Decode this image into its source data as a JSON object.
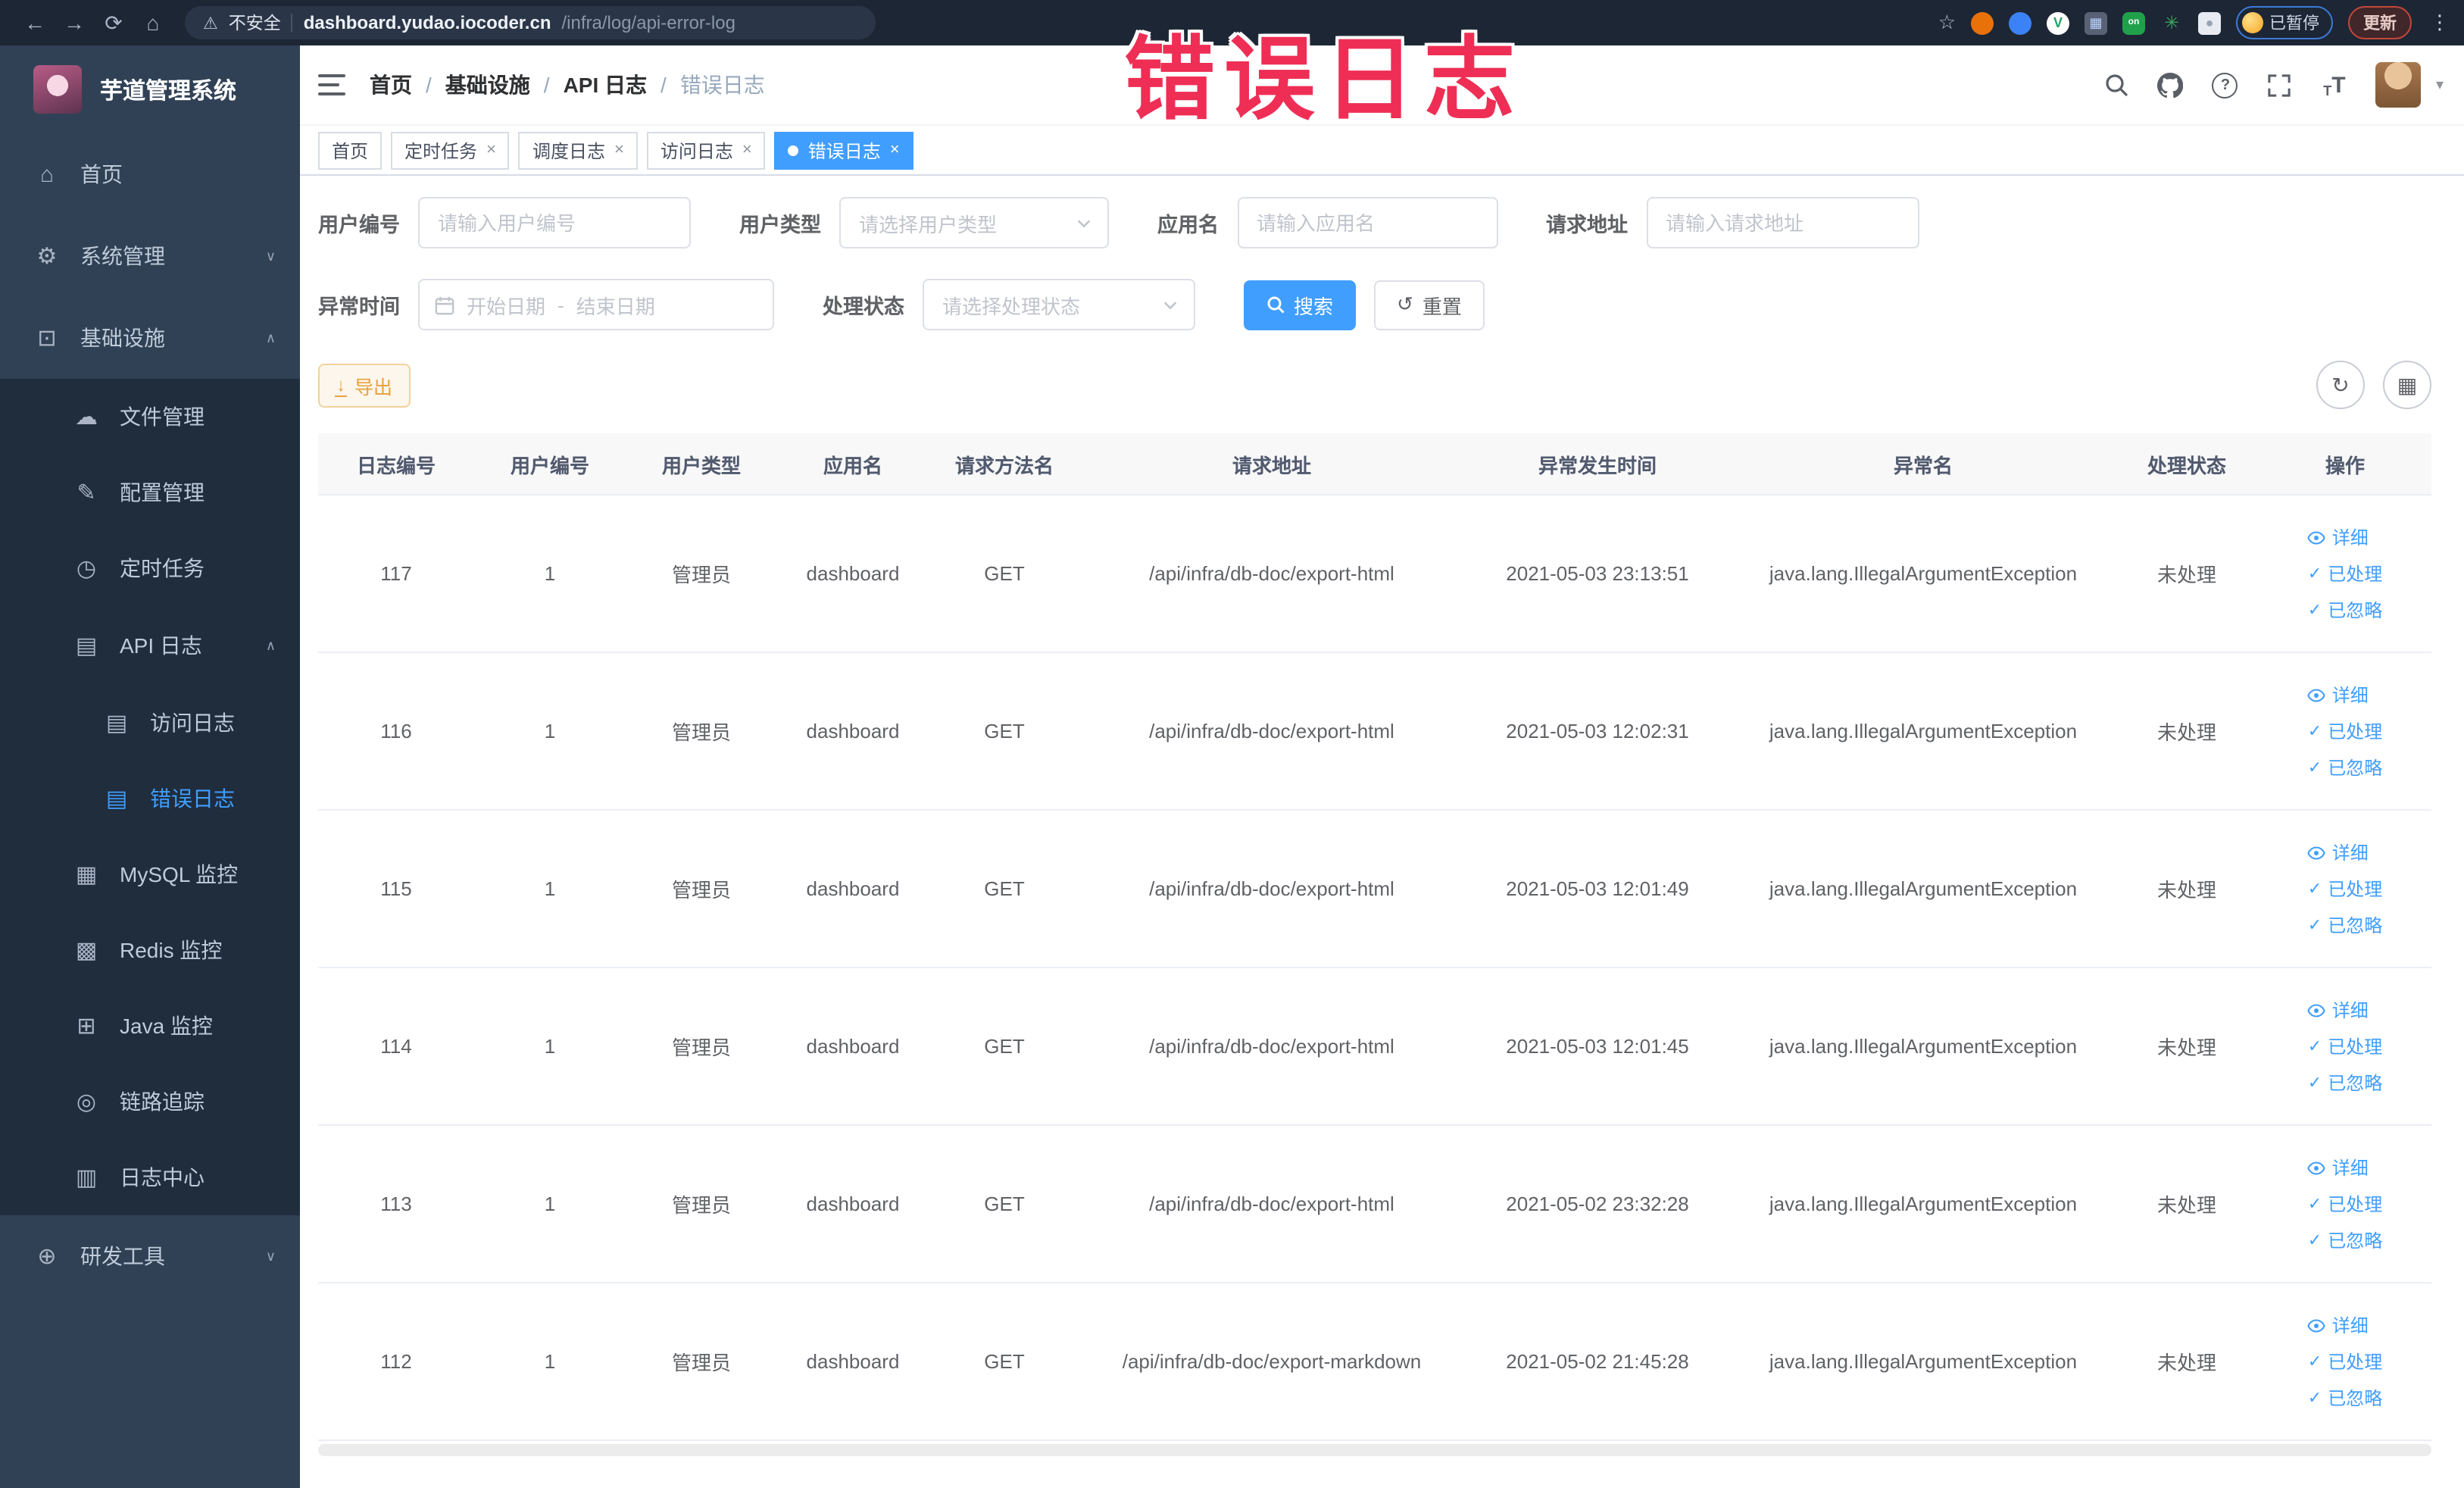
{
  "icons": {
    "back": "←",
    "forward": "→",
    "reload": "⟳",
    "home": "⌂",
    "warning": "⚠",
    "star": "☆",
    "dots": "⋮",
    "on_badge": "on",
    "close": "×",
    "breadcrumb_sep": "/",
    "caret_down": "▾",
    "check": "✓",
    "refresh": "↻",
    "reset": "↺",
    "columns_grid": "▦",
    "download_arrow": "↓",
    "ext_v": "V",
    "ext_grid": "▦",
    "ext_leaf": "✳",
    "ext_dot": "●",
    "home_glyph": "⌂",
    "gear_glyph": "⚙",
    "infra_glyph": "⊡",
    "cloud_glyph": "☁",
    "edit_glyph": "✎",
    "timer_glyph": "◷",
    "doc_glyph": "▤",
    "mysql_glyph": "▦",
    "redis_glyph": "▩",
    "java_glyph": "⊞",
    "eye_glyph": "◎",
    "logcenter_glyph": "▥",
    "tools_glyph": "⊕",
    "chev_down": "∨",
    "chev_up": "∧"
  },
  "browser": {
    "security_label": "不安全",
    "url_host": "dashboard.yudao.iocoder.cn",
    "url_path": "/infra/log/api-error-log",
    "paused_label": "已暂停",
    "update_label": "更新"
  },
  "overlay": {
    "text": "错误日志"
  },
  "sidebar": {
    "title": "芋道管理系统",
    "items": [
      {
        "label": "首页"
      },
      {
        "label": "系统管理"
      },
      {
        "label": "基础设施"
      },
      {
        "label": "文件管理"
      },
      {
        "label": "配置管理"
      },
      {
        "label": "定时任务"
      },
      {
        "label": "API 日志"
      },
      {
        "label": "访问日志"
      },
      {
        "label": "错误日志"
      },
      {
        "label": "MySQL 监控"
      },
      {
        "label": "Redis 监控"
      },
      {
        "label": "Java 监控"
      },
      {
        "label": "链路追踪"
      },
      {
        "label": "日志中心"
      },
      {
        "label": "研发工具"
      }
    ]
  },
  "breadcrumb": [
    "首页",
    "基础设施",
    "API 日志",
    "错误日志"
  ],
  "tabs": [
    {
      "label": "首页"
    },
    {
      "label": "定时任务"
    },
    {
      "label": "调度日志"
    },
    {
      "label": "访问日志"
    },
    {
      "label": "错误日志"
    }
  ],
  "filters": {
    "user_id": {
      "label": "用户编号",
      "placeholder": "请输入用户编号"
    },
    "user_type": {
      "label": "用户类型",
      "placeholder": "请选择用户类型"
    },
    "app_name": {
      "label": "应用名",
      "placeholder": "请输入应用名"
    },
    "request_url": {
      "label": "请求地址",
      "placeholder": "请输入请求地址"
    },
    "exception_time": {
      "label": "异常时间",
      "start": "开始日期",
      "separator": "-",
      "end": "结束日期"
    },
    "status": {
      "label": "处理状态",
      "placeholder": "请选择处理状态"
    },
    "search": "搜索",
    "reset": "重置"
  },
  "toolbar": {
    "export": "导出"
  },
  "table": {
    "columns": [
      "日志编号",
      "用户编号",
      "用户类型",
      "应用名",
      "请求方法名",
      "请求地址",
      "异常发生时间",
      "异常名",
      "处理状态",
      "操作"
    ],
    "row_actions": [
      "详细",
      "已处理",
      "已忽略"
    ],
    "rows": [
      {
        "id": "117",
        "user": "1",
        "type": "管理员",
        "app": "dashboard",
        "method": "GET",
        "url": "/api/infra/db-doc/export-html",
        "time": "2021-05-03 23:13:51",
        "exception": "java.lang.IllegalArgumentException",
        "status": "未处理"
      },
      {
        "id": "116",
        "user": "1",
        "type": "管理员",
        "app": "dashboard",
        "method": "GET",
        "url": "/api/infra/db-doc/export-html",
        "time": "2021-05-03 12:02:31",
        "exception": "java.lang.IllegalArgumentException",
        "status": "未处理"
      },
      {
        "id": "115",
        "user": "1",
        "type": "管理员",
        "app": "dashboard",
        "method": "GET",
        "url": "/api/infra/db-doc/export-html",
        "time": "2021-05-03 12:01:49",
        "exception": "java.lang.IllegalArgumentException",
        "status": "未处理"
      },
      {
        "id": "114",
        "user": "1",
        "type": "管理员",
        "app": "dashboard",
        "method": "GET",
        "url": "/api/infra/db-doc/export-html",
        "time": "2021-05-03 12:01:45",
        "exception": "java.lang.IllegalArgumentException",
        "status": "未处理"
      },
      {
        "id": "113",
        "user": "1",
        "type": "管理员",
        "app": "dashboard",
        "method": "GET",
        "url": "/api/infra/db-doc/export-html",
        "time": "2021-05-02 23:32:28",
        "exception": "java.lang.IllegalArgumentException",
        "status": "未处理"
      },
      {
        "id": "112",
        "user": "1",
        "type": "管理员",
        "app": "dashboard",
        "method": "GET",
        "url": "/api/infra/db-doc/export-markdown",
        "time": "2021-05-02 21:45:28",
        "exception": "java.lang.IllegalArgumentException",
        "status": "未处理"
      }
    ]
  },
  "colors": {
    "accent": "#409eff",
    "overlay_red": "#ef2e55",
    "warning": "#e6a23c",
    "sidebar": "#304156",
    "sidebar_dark": "#1f2d3d"
  }
}
